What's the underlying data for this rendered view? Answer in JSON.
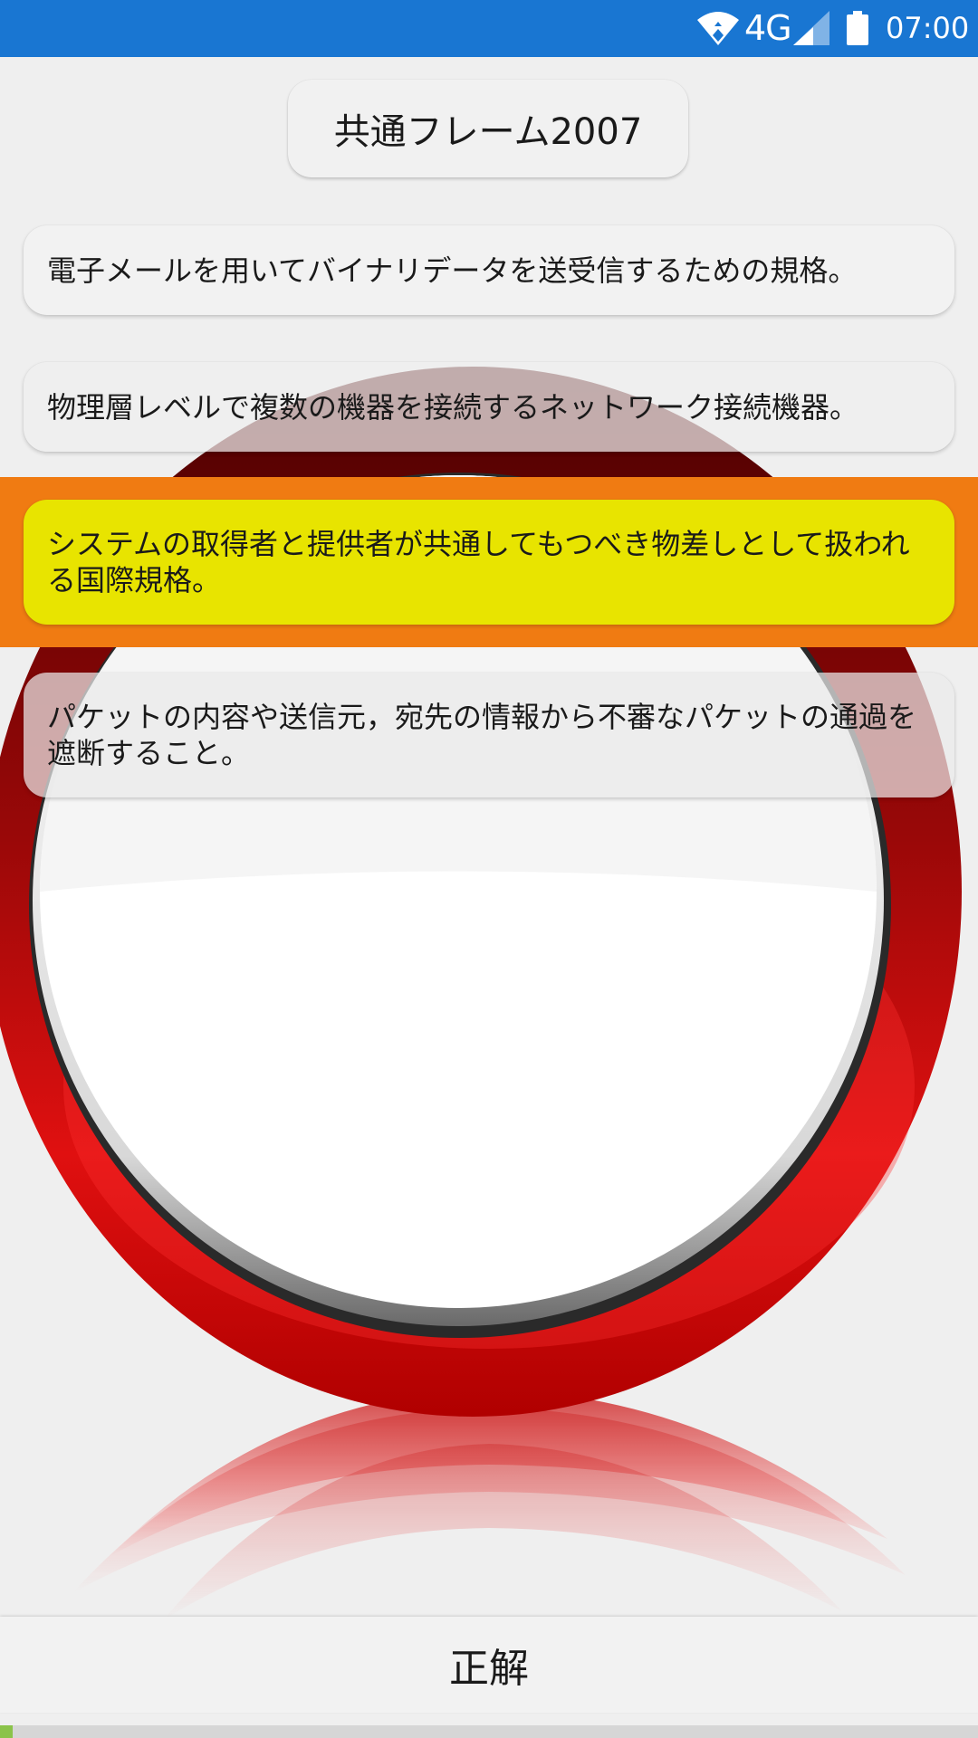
{
  "status_bar": {
    "network": "4G",
    "time": "07:00",
    "icons": [
      "wifi-icon",
      "signal-icon",
      "battery-icon"
    ],
    "background_color": "#1976d2"
  },
  "quiz": {
    "category": "共通フレーム2007",
    "choices": [
      "電子メールを用いてバイナリデータを送受信するための規格。",
      "物理層レベルで複数の機器を接続するネットワーク接続機器。",
      "システムの取得者と提供者が共通してもつべき物差しとして扱われる国際規格。",
      "パケットの内容や送信元，宛先の情報から不審なパケットの通過を遮断すること。"
    ],
    "selected_choice_index": 2,
    "result_graphic": "red-circle-correct-icon",
    "answer_button_label": "正解"
  },
  "colors": {
    "highlight_band": "#f07b12",
    "selected_choice": "#e8e400",
    "result_ring": "#e01010"
  }
}
